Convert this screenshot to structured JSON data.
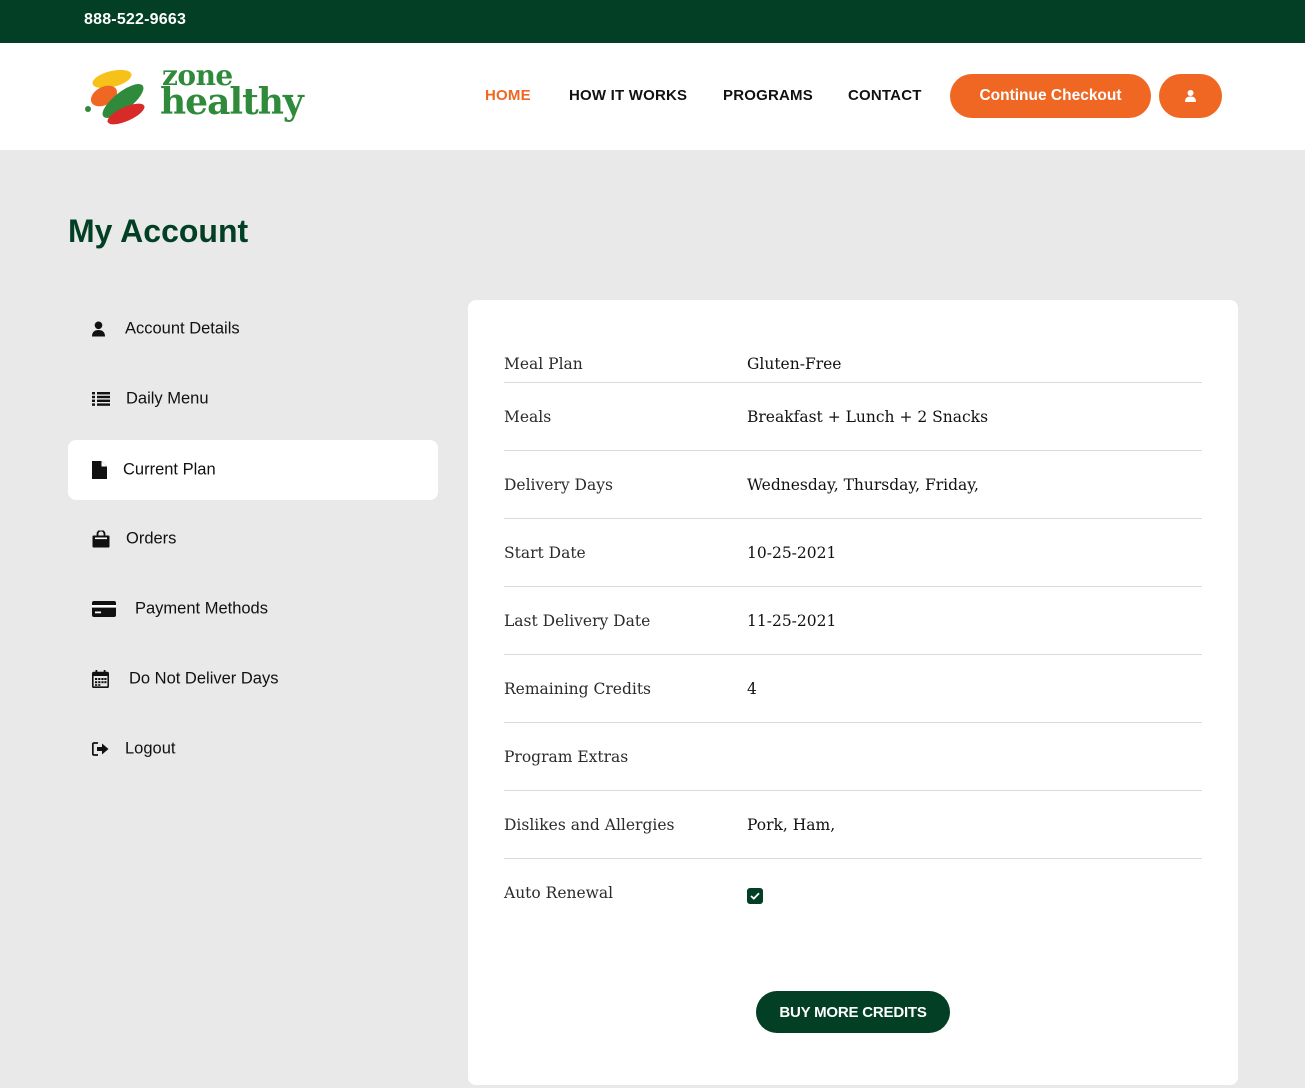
{
  "topbar": {
    "phone": "888-522-9663"
  },
  "brand": {
    "line1": "zone",
    "line2": "healthy"
  },
  "nav": {
    "items": [
      {
        "label": "HOME",
        "active": true
      },
      {
        "label": "HOW IT WORKS",
        "active": false
      },
      {
        "label": "PROGRAMS",
        "active": false
      },
      {
        "label": "CONTACT",
        "active": false
      }
    ],
    "checkout_label": "Continue Checkout",
    "user_icon": "user-icon"
  },
  "page": {
    "title": "My Account"
  },
  "sidebar": {
    "items": [
      {
        "label": "Account Details",
        "icon": "user-icon"
      },
      {
        "label": "Daily Menu",
        "icon": "list-icon"
      },
      {
        "label": "Current Plan",
        "icon": "file-icon",
        "active": true
      },
      {
        "label": "Orders",
        "icon": "shopping-bag-icon"
      },
      {
        "label": "Payment Methods",
        "icon": "credit-card-icon"
      },
      {
        "label": "Do Not Deliver Days",
        "icon": "calendar-icon"
      },
      {
        "label": "Logout",
        "icon": "sign-out-icon"
      }
    ]
  },
  "plan": {
    "rows": [
      {
        "label": "Meal Plan",
        "value": "Gluten-Free"
      },
      {
        "label": "Meals",
        "value": "Breakfast + Lunch + 2 Snacks"
      },
      {
        "label": "Delivery Days",
        "value": "Wednesday, Thursday, Friday,"
      },
      {
        "label": "Start Date",
        "value": "10-25-2021"
      },
      {
        "label": "Last Delivery Date",
        "value": "11-25-2021"
      },
      {
        "label": "Remaining Credits",
        "value": "4"
      },
      {
        "label": "Program Extras",
        "value": ""
      },
      {
        "label": "Dislikes and Allergies",
        "value": "Pork, Ham,"
      },
      {
        "label": "Auto Renewal",
        "value": ""
      }
    ],
    "auto_renewal_checked": true,
    "buy_label": "BUY MORE CREDITS"
  },
  "colors": {
    "dark_green": "#023f24",
    "orange": "#ef6723",
    "brand_green": "#2f8b3b",
    "page_bg": "#e9e9e9"
  }
}
